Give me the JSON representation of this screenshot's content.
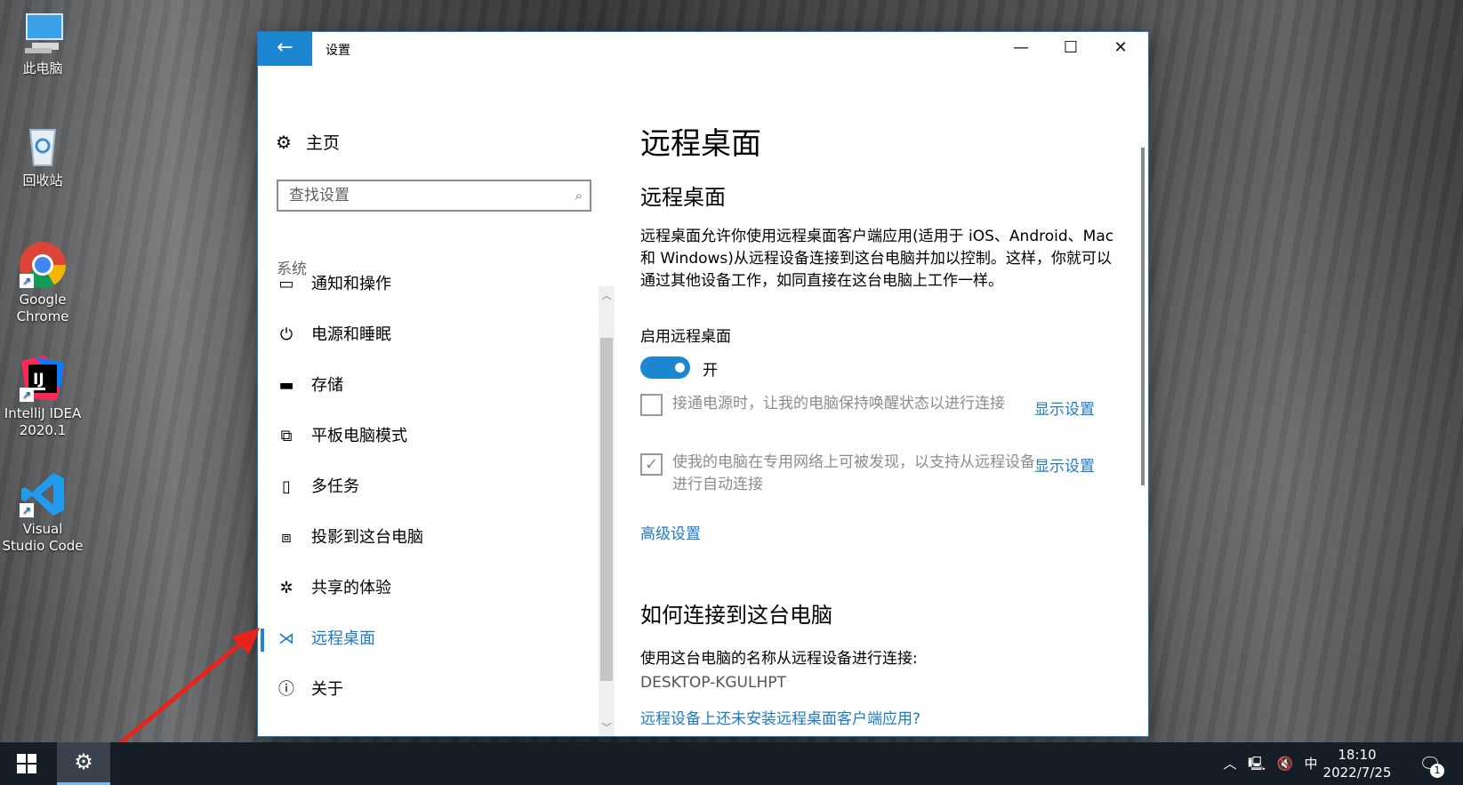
{
  "desktop": {
    "icons": [
      {
        "label": "此电脑",
        "icon": "computer-icon"
      },
      {
        "label": "回收站",
        "icon": "recycle-bin-icon"
      },
      {
        "label": "Google Chrome",
        "icon": "chrome-icon"
      },
      {
        "label": "IntelliJ IDEA 2020.1",
        "icon": "intellij-icon"
      },
      {
        "label": "Visual Studio Code",
        "icon": "vscode-icon"
      }
    ]
  },
  "window": {
    "title": "设置",
    "controls": {
      "minimize": "—",
      "maximize": "☐",
      "close": "✕"
    }
  },
  "sidebar": {
    "home_label": "主页",
    "search_placeholder": "查找设置",
    "section_label": "系统",
    "items": [
      {
        "label": "通知和操作",
        "icon": "notification-icon"
      },
      {
        "label": "电源和睡眠",
        "icon": "power-icon"
      },
      {
        "label": "存储",
        "icon": "storage-icon"
      },
      {
        "label": "平板电脑模式",
        "icon": "tablet-mode-icon"
      },
      {
        "label": "多任务",
        "icon": "multitask-icon"
      },
      {
        "label": "投影到这台电脑",
        "icon": "project-icon"
      },
      {
        "label": "共享的体验",
        "icon": "shared-experience-icon"
      },
      {
        "label": "远程桌面",
        "icon": "remote-desktop-icon",
        "active": true
      },
      {
        "label": "关于",
        "icon": "info-icon"
      }
    ]
  },
  "content": {
    "page_title": "远程桌面",
    "section_title": "远程桌面",
    "description": "远程桌面允许你使用远程桌面客户端应用(适用于 iOS、Android、Mac 和 Windows)从远程设备连接到这台电脑并加以控制。这样，你就可以通过其他设备工作，如同直接在这台电脑上工作一样。",
    "enable_label": "启用远程桌面",
    "toggle_state": "开",
    "toggle_on": true,
    "option1": {
      "text": "接通电源时，让我的电脑保持唤醒状态以进行连接",
      "link": "显示设置",
      "checked": false
    },
    "option2": {
      "text": "使我的电脑在专用网络上可被发现，以支持从远程设备进行自动连接",
      "link": "显示设置",
      "checked": true
    },
    "advanced_link": "高级设置",
    "how_title": "如何连接到这台电脑",
    "how_text": "使用这台电脑的名称从远程设备进行连接:",
    "pc_name": "DESKTOP-KGULHPT",
    "client_link": "远程设备上还未安装远程桌面客户端应用?"
  },
  "taskbar": {
    "ime": "中",
    "time": "18:10",
    "date": "2022/7/25",
    "notification_count": "1"
  },
  "colors": {
    "accent": "#1c86d0",
    "link": "#1c7ac7",
    "annotation_arrow": "#e8231b"
  }
}
